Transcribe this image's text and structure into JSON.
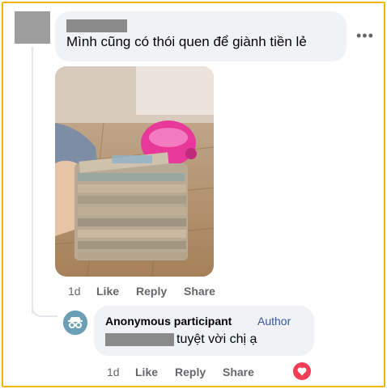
{
  "comment": {
    "text": "Mình cũng có thói quen để giành tiền lẻ",
    "more_label": "•••",
    "actions": {
      "time": "1d",
      "like": "Like",
      "reply": "Reply",
      "share": "Share"
    }
  },
  "reply": {
    "author": "Anonymous participant",
    "badge": "Author",
    "text": "tuyệt vời chị ạ",
    "actions": {
      "time": "1d",
      "like": "Like",
      "reply": "Reply",
      "share": "Share"
    },
    "reaction": "heart"
  },
  "colors": {
    "frame_border": "#f2b705",
    "bubble_bg": "#f0f2f5",
    "action_text": "#65676b",
    "badge_text": "#385898",
    "reaction_heart": "#f33e58"
  }
}
